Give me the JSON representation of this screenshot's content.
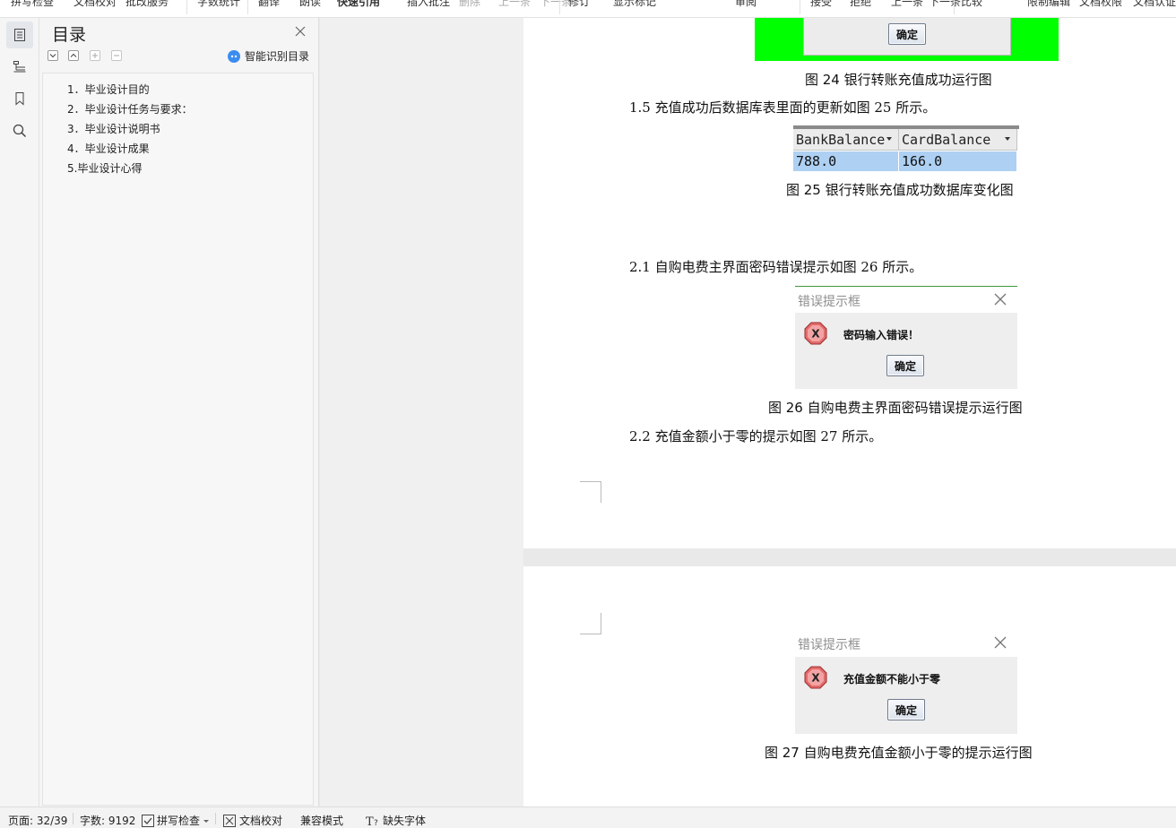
{
  "toolbar": {
    "items": [
      "拼写检查",
      "文档校对",
      "批改服务",
      "字数统计",
      "翻译",
      "朗读",
      "快速引用",
      "插入批注",
      "删除",
      "上一条",
      "下一条",
      "修订",
      "显示标记",
      "审阅",
      "接受",
      "拒绝",
      "上一条",
      "下一条",
      "比较",
      "限制编辑",
      "文档权限",
      "文档认证"
    ]
  },
  "rail": {
    "icons": [
      "toc-icon",
      "nav-pane-icon",
      "bookmark-icon",
      "search-icon"
    ]
  },
  "toc": {
    "title": "目录",
    "smart_label": "智能识别目录",
    "items": [
      "1．毕业设计目的",
      "2．毕业设计任务与要求：",
      "3．毕业设计说明书",
      "4．毕业设计成果",
      "5.毕业设计心得"
    ]
  },
  "doc": {
    "fig24_caption": "图 24    银行转账充值成功运行图",
    "green_button": "确定",
    "para_1_5": "1.5 充值成功后数据库表里面的更新如图 25 所示。",
    "db_headers": [
      "BankBalance",
      "CardBalance"
    ],
    "db_values": [
      "788.0",
      "166.0"
    ],
    "fig25_caption": "图 25  银行转账充值成功数据库变化图",
    "para_2_1": "2.1 自购电费主界面密码错误提示如图 26 所示。",
    "dlg1": {
      "title": "错误提示框",
      "message": "密码输入错误！",
      "button": "确定"
    },
    "fig26_caption": "图 26    自购电费主界面密码错误提示运行图",
    "para_2_2": "2.2 充值金额小于零的提示如图 27 所示。",
    "dlg2": {
      "title": "错误提示框",
      "message": "充值金额不能小于零",
      "button": "确定"
    },
    "fig27_caption": "图 27  自购电费充值金额小于零的提示运行图"
  },
  "status": {
    "page": "页面: 32/39",
    "words": "字数: 9192",
    "spell": "拼写检查",
    "proof": "文档校对",
    "compat": "兼容模式",
    "missing_font": "缺失字体"
  }
}
